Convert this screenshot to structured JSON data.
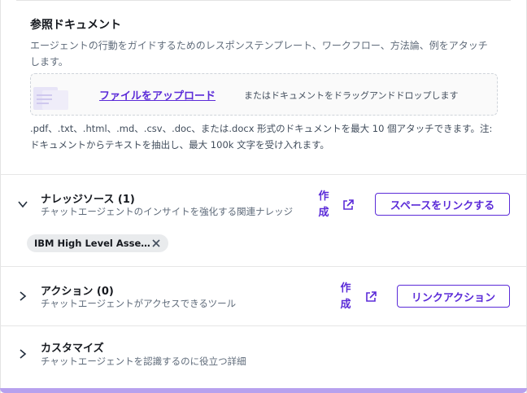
{
  "reference": {
    "title": "参照ドキュメント",
    "description": "エージェントの行動をガイドするためのレスポンステンプレート、ワークフロー、方法論、例をアタッチします。",
    "upload_link": "ファイルをアップロード",
    "drop_hint": "またはドキュメントをドラッグアンドドロップします",
    "formats": ".pdf、.txt、.html、.md、.csv、.doc、または.docx 形式のドキュメントを最大 10 個アタッチできます。注: ドキュメントからテキストを抽出し、最大 100k 文字を受け入れます。"
  },
  "knowledge": {
    "title": "ナレッジソース (1)",
    "subtitle": "チャットエージェントのインサイトを強化する関連ナレッジ",
    "create_label": "作成",
    "link_button": "スペースをリンクする",
    "chip_label": "IBM High Level Asse…",
    "expanded": true
  },
  "actions": {
    "title": "アクション (0)",
    "subtitle": "チャットエージェントがアクセスできるツール",
    "create_label": "作成",
    "link_button": "リンクアクション"
  },
  "customize": {
    "title": "カスタマイズ",
    "subtitle": "チャットエージェントを認識するのに役立つ詳細"
  },
  "colors": {
    "accent": "#5b2bd8",
    "border": "#e6e6e6",
    "muted_text": "#5f6b7a"
  }
}
